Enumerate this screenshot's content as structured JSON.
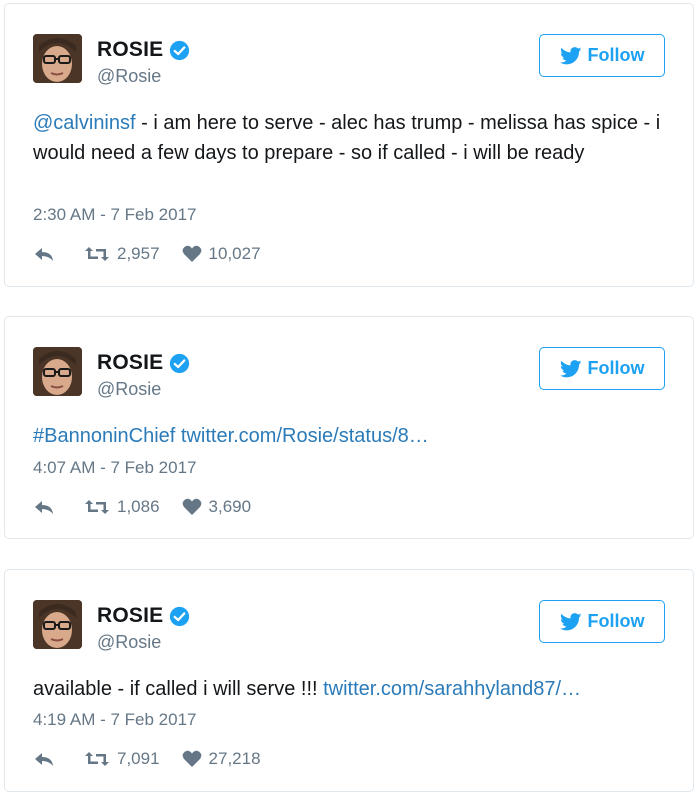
{
  "colors": {
    "accent": "#1da1f2",
    "link": "#2b7bb9",
    "muted": "#657786",
    "border": "#e1e8ed"
  },
  "tweets": [
    {
      "name": "ROSIE",
      "handle": "@Rosie",
      "follow_label": "Follow",
      "mention": "@calvininsf",
      "body": " - i am here to serve - alec has trump - melissa has spice - i would need a few days to prepare - so if called - i will be ready",
      "timestamp": "2:30 AM - 7 Feb 2017",
      "retweets": "2,957",
      "likes": "10,027"
    },
    {
      "name": "ROSIE",
      "handle": "@Rosie",
      "follow_label": "Follow",
      "link_text": "#BannoninChief twitter.com/Rosie/status/8…",
      "timestamp": "4:07 AM - 7 Feb 2017",
      "retweets": "1,086",
      "likes": "3,690"
    },
    {
      "name": "ROSIE",
      "handle": "@Rosie",
      "follow_label": "Follow",
      "body": "available - if called i will serve !!! ",
      "link_text": "twitter.com/sarahhyland87/…",
      "timestamp": "4:19 AM - 7 Feb 2017",
      "retweets": "7,091",
      "likes": "27,218"
    }
  ]
}
